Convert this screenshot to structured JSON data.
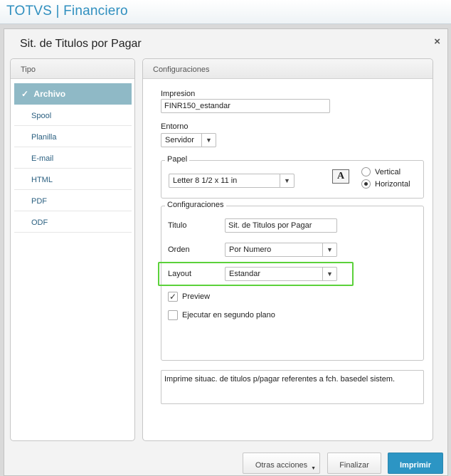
{
  "app": {
    "title": "TOTVS | Financiero"
  },
  "dialog": {
    "title": "Sit. de Titulos por Pagar",
    "close_icon": "×"
  },
  "tipo": {
    "header": "Tipo",
    "items": [
      {
        "label": "Archivo",
        "check": "✓"
      },
      {
        "label": "Spool"
      },
      {
        "label": "Planilla"
      },
      {
        "label": "E-mail"
      },
      {
        "label": "HTML"
      },
      {
        "label": "PDF"
      },
      {
        "label": "ODF"
      }
    ]
  },
  "config": {
    "header": "Configuraciones",
    "impresion": {
      "label": "Impresion",
      "value": "FINR150_estandar"
    },
    "entorno": {
      "label": "Entorno",
      "value": "Servidor"
    },
    "papel": {
      "legend": "Papel",
      "value": "Letter 8 1/2 x 11 in",
      "icon": "A",
      "vertical": "Vertical",
      "horizontal": "Horizontal"
    },
    "configuraciones": {
      "legend": "Configuraciones",
      "titulo": {
        "label": "Titulo",
        "value": "Sit. de Titulos por Pagar"
      },
      "orden": {
        "label": "Orden",
        "value": "Por Numero"
      },
      "layout": {
        "label": "Layout",
        "value": "Estandar"
      },
      "preview": {
        "label": "Preview",
        "check": "✓"
      },
      "segundo_plano": {
        "label": "Ejecutar en segundo plano"
      }
    },
    "description": "Imprime situac. de titulos p/pagar referentes a fch. basedel sistem."
  },
  "footer": {
    "otras": "Otras acciones",
    "finalizar": "Finalizar",
    "imprimir": "Imprimir"
  },
  "colors": {
    "accent": "#2c95c4",
    "selected": "#8fb9c6",
    "highlight": "#5bd13a",
    "title": "#2f8fbf"
  }
}
